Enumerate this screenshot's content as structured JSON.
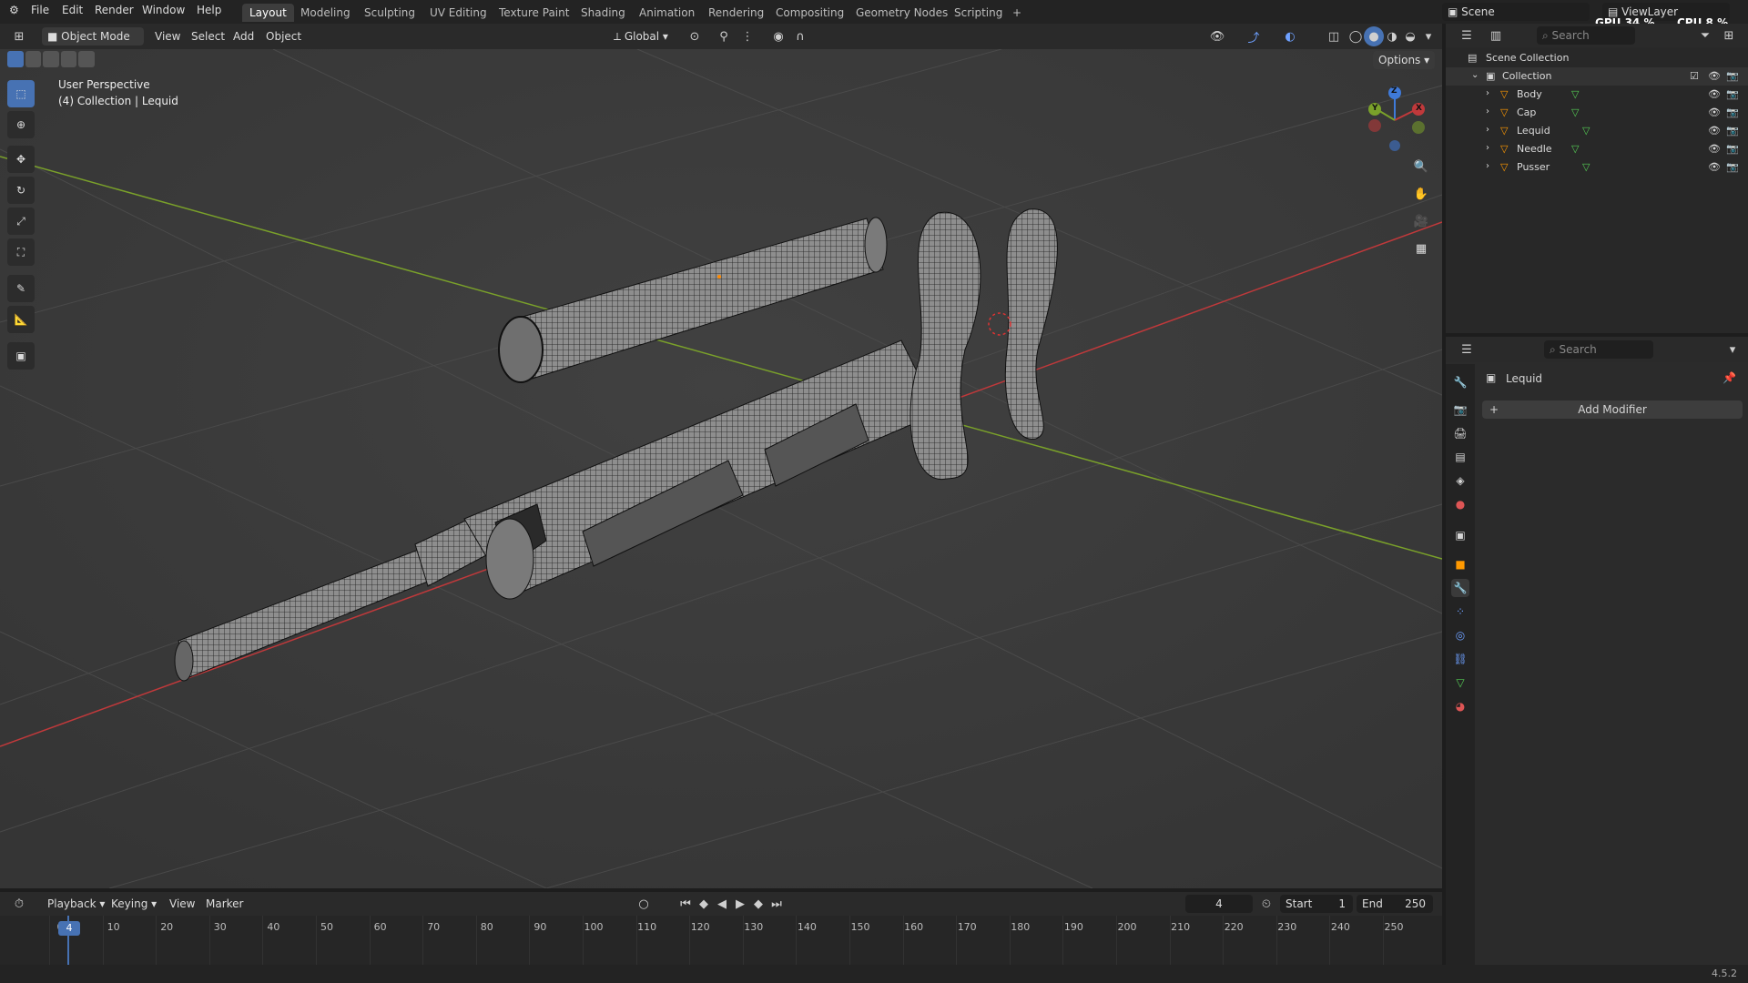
{
  "top_menu": [
    "File",
    "Edit",
    "Render",
    "Window",
    "Help"
  ],
  "workspaces": [
    {
      "label": "Layout",
      "active": true
    },
    {
      "label": "Modeling"
    },
    {
      "label": "Sculpting"
    },
    {
      "label": "UV Editing"
    },
    {
      "label": "Texture Paint"
    },
    {
      "label": "Shading"
    },
    {
      "label": "Animation"
    },
    {
      "label": "Rendering"
    },
    {
      "label": "Compositing"
    },
    {
      "label": "Geometry Nodes"
    },
    {
      "label": "Scripting"
    }
  ],
  "scene": {
    "name": "Scene",
    "view_layer": "ViewLayer"
  },
  "perf": {
    "gpu_label": "GPU",
    "gpu_value": "34 %",
    "cpu_label": "CPU",
    "cpu_value": "8 %"
  },
  "viewport_header": {
    "mode": "Object Mode",
    "menus": [
      "View",
      "Select",
      "Add",
      "Object"
    ],
    "orientation": "Global",
    "options": "Options"
  },
  "viewport": {
    "perspective": "User Perspective",
    "context": "(4) Collection | Lequid",
    "gizmo": {
      "x": "X",
      "y": "Y",
      "z": "Z"
    }
  },
  "outliner": {
    "search_placeholder": "Search",
    "scene_collection": "Scene Collection",
    "collection": "Collection",
    "objects": [
      "Body",
      "Cap",
      "Lequid",
      "Needle",
      "Pusser"
    ]
  },
  "properties": {
    "search_placeholder": "Search",
    "object_name": "Lequid",
    "add_modifier": "Add Modifier"
  },
  "timeline": {
    "menus": [
      "Playback",
      "Keying",
      "View",
      "Marker"
    ],
    "current_frame": "4",
    "start_label": "Start",
    "start": "1",
    "end_label": "End",
    "end": "250",
    "ticks": [
      "0",
      "10",
      "20",
      "30",
      "40",
      "50",
      "60",
      "70",
      "80",
      "90",
      "100",
      "110",
      "120",
      "130",
      "140",
      "150",
      "160",
      "170",
      "180",
      "190",
      "200",
      "210",
      "220",
      "230",
      "240",
      "250"
    ]
  },
  "version": "4.5.2",
  "colors": {
    "accent": "#4772b3",
    "x_axis": "#c0393b",
    "y_axis": "#7aa12a",
    "z_axis": "#3f7ad9"
  }
}
